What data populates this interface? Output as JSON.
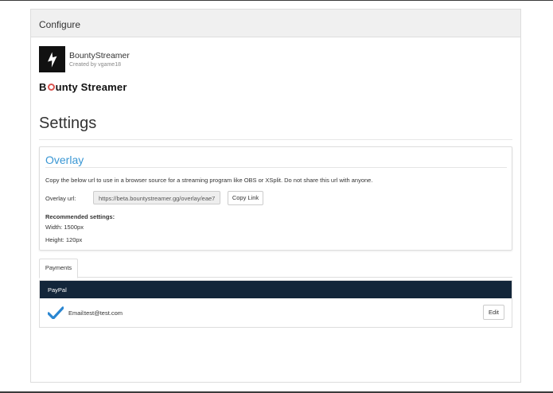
{
  "panel": {
    "header": "Configure"
  },
  "extension": {
    "name": "BountyStreamer",
    "created_by": "Created by vgame18",
    "logo_icon": "lightning-bolt-icon"
  },
  "brand": {
    "prefix": "B",
    "suffix": "unty Streamer",
    "ring_color": "#d9534f"
  },
  "page": {
    "title": "Settings"
  },
  "overlay": {
    "title": "Overlay",
    "description": "Copy the below url to use in a browser source for a streaming program like OBS or XSplit. Do not share this url with anyone.",
    "url_label": "Overlay url:",
    "url_value": "https://beta.bountystreamer.gg/overlay/eae7",
    "copy_button": "Copy Link",
    "recommended_title": "Recommended settings:",
    "width": "Width: 1500px",
    "height": "Height: 120px",
    "title_color": "#3a97d4"
  },
  "tabs": [
    {
      "label": "Payments",
      "active": true
    }
  ],
  "payments": {
    "provider": "PayPal",
    "header_color": "#13263a",
    "email_label": "Email:",
    "email_value": "test@test.com",
    "status_icon": "checkmark-icon",
    "edit_button": "Edit"
  }
}
